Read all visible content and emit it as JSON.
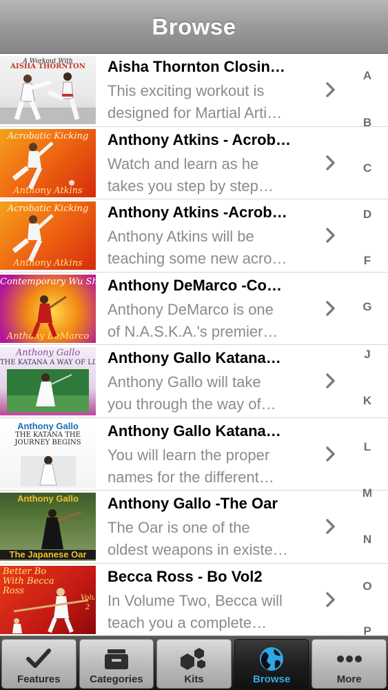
{
  "navbar": {
    "title": "Browse"
  },
  "items": [
    {
      "title": "Aisha Thornton Closin…",
      "desc_line1": "This exciting workout is",
      "desc_line2": "designed for Martial Arti…",
      "cover_text_top": "A Workout With",
      "cover_text_bottom": "AISHA THORNTON"
    },
    {
      "title": "Anthony Atkins - Acrob…",
      "desc_line1": "Watch and learn as he",
      "desc_line2": "takes you step by step…",
      "cover_text_top": "Acrobatic Kicking",
      "cover_text_bottom": "Anthony Atkins"
    },
    {
      "title": "Anthony Atkins -Acrob…",
      "desc_line1": "Anthony Atkins will be",
      "desc_line2": "teaching some new acro…",
      "cover_text_top": "Acrobatic Kicking",
      "cover_text_bottom": "Anthony Atkins"
    },
    {
      "title": "Anthony DeMarco -Co…",
      "desc_line1": "Anthony DeMarco is one",
      "desc_line2": "of N.A.S.K.A.'s premier…",
      "cover_text_top": "Contemporary Wu Shu",
      "cover_text_bottom": "Anthony DeMarco"
    },
    {
      "title": "Anthony Gallo Katana…",
      "desc_line1": "Anthony Gallo will take",
      "desc_line2": "you through the way of…",
      "cover_text_top": "Anthony Gallo",
      "cover_text_bottom": "THE KATANA A WAY OF LIFE"
    },
    {
      "title": "Anthony Gallo Katana…",
      "desc_line1": "You will learn the proper",
      "desc_line2": "names for the different…",
      "cover_text_top": "Anthony Gallo",
      "cover_text_bottom": "THE KATANA THE JOURNEY BEGINS"
    },
    {
      "title": "Anthony Gallo -The Oar",
      "desc_line1": "The Oar is one of the",
      "desc_line2": "oldest weapons in existe…",
      "cover_text_top": "Anthony Gallo",
      "cover_text_bottom": "The Japanese Oar"
    },
    {
      "title": "Becca Ross - Bo Vol2",
      "desc_line1": "In Volume Two, Becca will",
      "desc_line2": "teach you a complete…",
      "cover_text_top": "Better Bo With Becca Ross",
      "cover_text_bottom": "Volume 2"
    }
  ],
  "index_letters": [
    "A",
    "B",
    "C",
    "D",
    "F",
    "G",
    "J",
    "K",
    "L",
    "M",
    "N",
    "O",
    "P"
  ],
  "tabs": [
    {
      "label": "Features",
      "icon": "checkmark-icon"
    },
    {
      "label": "Categories",
      "icon": "drawer-icon"
    },
    {
      "label": "Kits",
      "icon": "boxes-icon"
    },
    {
      "label": "Browse",
      "icon": "globe-icon"
    },
    {
      "label": "More",
      "icon": "more-dots-icon"
    }
  ],
  "active_tab": "Browse",
  "colors": {
    "navbar": "#9a9a9a",
    "title_text": "#000000",
    "desc_text": "#8b8b8b",
    "active_tab_label": "#35a9e8",
    "index_text": "#6d6d6d"
  }
}
